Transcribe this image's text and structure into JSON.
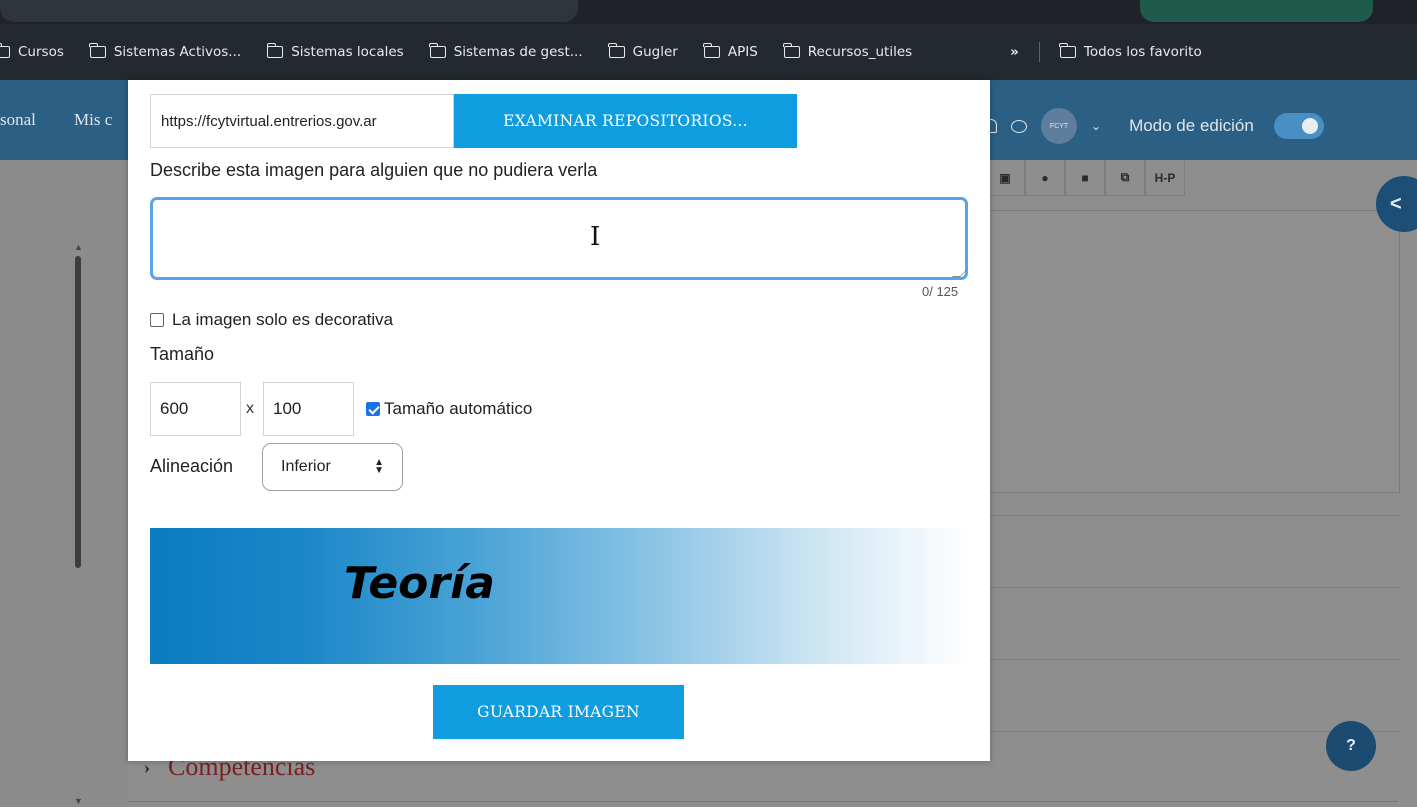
{
  "bookmarks": {
    "items": [
      {
        "label": "Cursos"
      },
      {
        "label": "Sistemas Activos..."
      },
      {
        "label": "Sistemas locales"
      },
      {
        "label": "Sistemas de gest..."
      },
      {
        "label": "Gugler"
      },
      {
        "label": "APIS"
      },
      {
        "label": "Recursos_utiles"
      }
    ],
    "more_label": "»",
    "all_label": "Todos los favorito"
  },
  "navbar": {
    "left_text_1": "sonal",
    "left_text_2": "Mis c",
    "avatar_text": "FCYT",
    "edit_mode_label": "Modo de edición",
    "edit_mode_on": true
  },
  "modal": {
    "url_value": "https://fcytvirtual.entrerios.gov.ar",
    "browse_button": "EXAMINAR REPOSITORIOS...",
    "alt_label": "Describe esta imagen para alguien que no pudiera verla",
    "alt_value": "",
    "alt_counter": "0/ 125",
    "decorative_label": "La imagen solo es decorativa",
    "decorative_checked": false,
    "size_label": "Tamaño",
    "width_value": "600",
    "size_separator": "x",
    "height_value": "100",
    "auto_size_label": "Tamaño automático",
    "auto_size_checked": true,
    "align_label": "Alineación",
    "align_value": "Inferior",
    "preview_text": "Teoría",
    "save_button": "GUARDAR IMAGEN"
  },
  "page": {
    "toolbar_h5p": "H-P",
    "section_title": "Competencias",
    "help_label": "?",
    "drawer_label": "<"
  },
  "colors": {
    "accent": "#0f9de0",
    "navbar": "#2b5f83",
    "focus_ring": "#5aa3e6",
    "section_title": "#7a2020"
  }
}
